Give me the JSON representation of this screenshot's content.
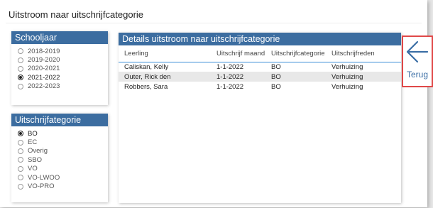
{
  "page": {
    "title": "Uitstroom naar uitschrijfcategorie"
  },
  "schooljaar": {
    "title": "Schooljaar",
    "options": [
      {
        "label": "2018-2019",
        "selected": false
      },
      {
        "label": "2019-2020",
        "selected": false
      },
      {
        "label": "2020-2021",
        "selected": false
      },
      {
        "label": "2021-2022",
        "selected": true
      },
      {
        "label": "2022-2023",
        "selected": false
      }
    ]
  },
  "categorie": {
    "title": "Uitschrijfategorie",
    "options": [
      {
        "label": "BO",
        "selected": true
      },
      {
        "label": "EC",
        "selected": false
      },
      {
        "label": "Overig",
        "selected": false
      },
      {
        "label": "SBO",
        "selected": false
      },
      {
        "label": "VO",
        "selected": false
      },
      {
        "label": "VO-LWOO",
        "selected": false
      },
      {
        "label": "VO-PRO",
        "selected": false
      }
    ]
  },
  "details": {
    "title": "Details uitstroom naar uitschrijfcategorie",
    "columns": [
      "Leerling",
      "Uitschrijf maand",
      "Uitschrijfcategorie",
      "Uitschrijfreden"
    ],
    "rows": [
      [
        "Caliskan, Kelly",
        "1-1-2022",
        "BO",
        "Verhuizing"
      ],
      [
        "Outer, Rick den",
        "1-1-2022",
        "BO",
        "Verhuizing"
      ],
      [
        "Robbers, Sara",
        "1-1-2022",
        "BO",
        "Verhuizing"
      ]
    ]
  },
  "back": {
    "label": "Terug",
    "icon": "arrow-left-icon"
  },
  "colors": {
    "header": "#3c6da0",
    "accent_line": "#3c8fd8",
    "back_border": "#e04848",
    "back_icon": "#3a6ea5"
  }
}
